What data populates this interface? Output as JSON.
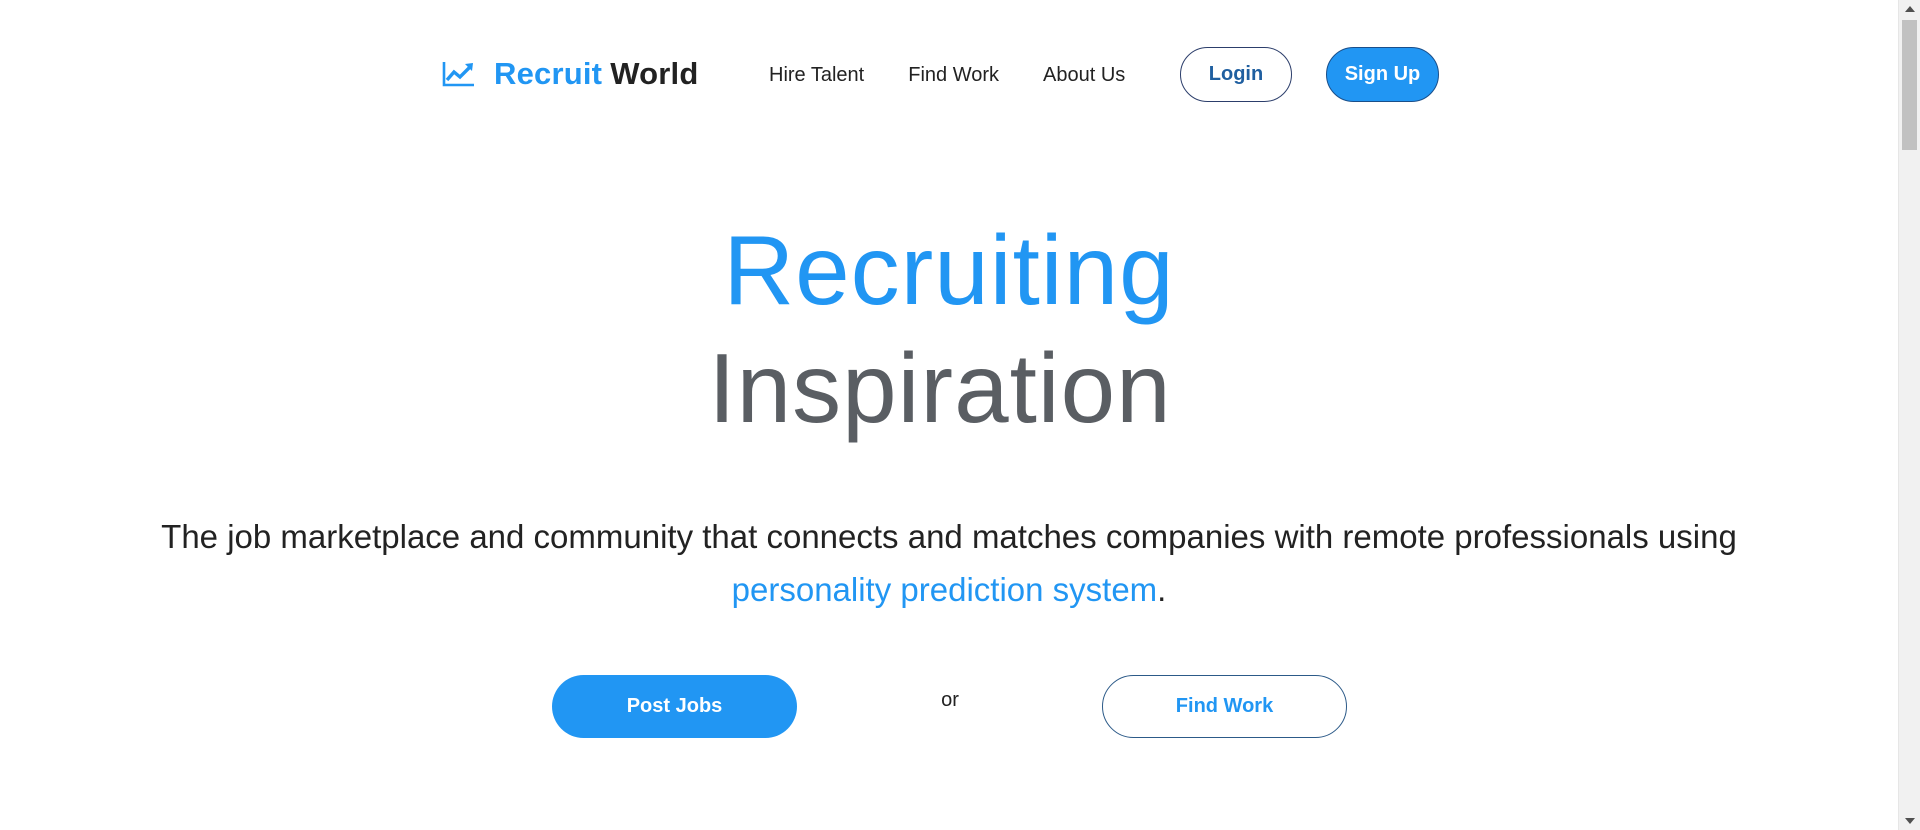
{
  "header": {
    "brand": {
      "icon": "trending-up-icon",
      "first": "Recruit",
      "second": "World"
    },
    "nav": [
      {
        "label": "Hire Talent"
      },
      {
        "label": "Find Work"
      },
      {
        "label": "About Us"
      }
    ],
    "login_label": "Login",
    "signup_label": "Sign Up"
  },
  "hero": {
    "title_line1": "Recruiting",
    "title_line2": "Inspiration",
    "tagline_main": "The job marketplace and community that connects and matches companies with remote professionals using",
    "tagline_highlight": "personality prediction system",
    "tagline_end": ".",
    "cta_primary": "Post Jobs",
    "cta_separator": "or",
    "cta_secondary": "Find Work"
  },
  "colors": {
    "accent": "#2196F3",
    "text_dark": "#222222",
    "title_gray": "#5a5e63"
  }
}
